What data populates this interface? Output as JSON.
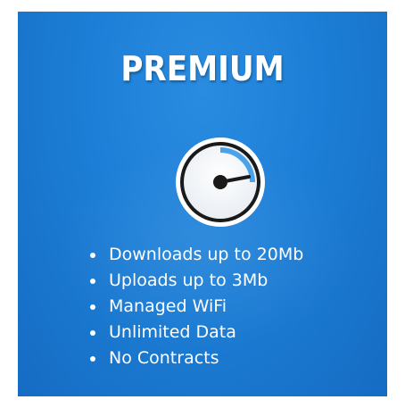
{
  "plan": {
    "title": "PREMIUM",
    "icon": "speedometer-icon",
    "features": [
      "Downloads up to 20Mb",
      "Uploads up to 3Mb",
      "Managed WiFi",
      "Unlimited Data",
      "No Contracts"
    ]
  },
  "colors": {
    "card_background": "#1c7ed6",
    "text": "#ffffff",
    "gauge_arc": "#4aa3e8",
    "gauge_needle": "#1a1a1a"
  }
}
